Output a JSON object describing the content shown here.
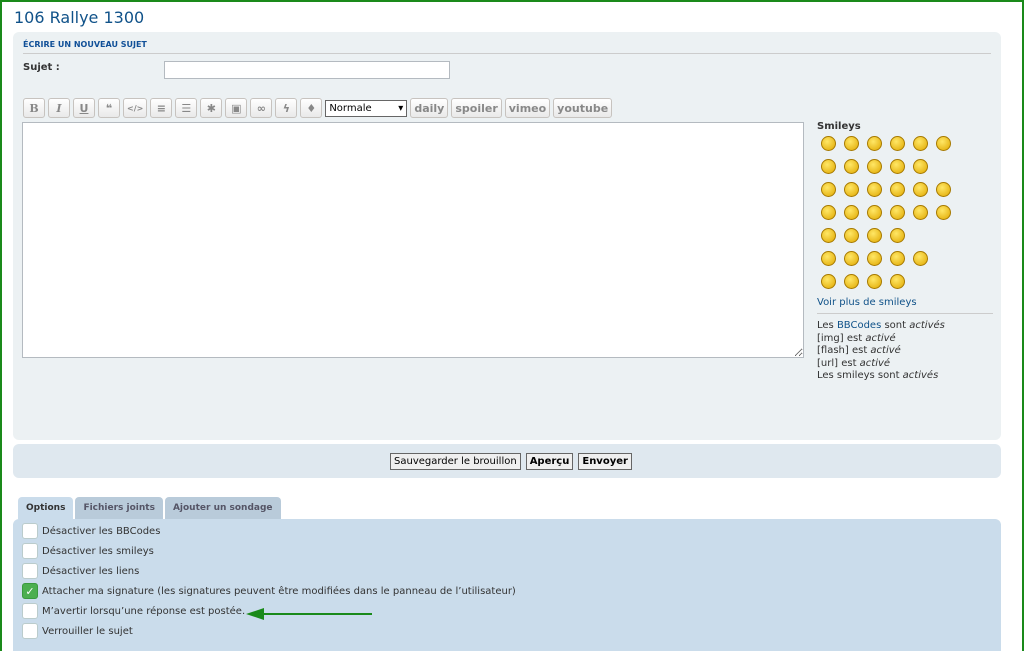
{
  "page": {
    "title": "106 Rallye 1300"
  },
  "form": {
    "header": "ÉCRIRE UN NOUVEAU SUJET",
    "subject_label": "Sujet :",
    "subject_value": ""
  },
  "toolbar": {
    "buttons": [
      "B",
      "I",
      "U",
      "❝",
      "</>",
      "≡",
      "☰",
      "✱",
      "▣",
      "∞",
      "ϟ",
      "♦"
    ],
    "font_size": "Normale",
    "extra": [
      "daily",
      "spoiler",
      "vimeo",
      "youtube"
    ]
  },
  "smileys": {
    "title": "Smileys",
    "rows": [
      6,
      5,
      6,
      6,
      4,
      5,
      4
    ],
    "more": "Voir plus de smileys"
  },
  "info": {
    "bbcode_pre": "Les ",
    "bbcode_link": "BBCodes",
    "bbcode_post": " sont ",
    "bbcode_state": "activés",
    "img": "[img] est ",
    "img_state": "activé",
    "flash": "[flash] est ",
    "flash_state": "activé",
    "url": "[url] est ",
    "url_state": "activé",
    "smileys": "Les smileys sont ",
    "smileys_state": "activés"
  },
  "actions": {
    "draft": "Sauvegarder le brouillon",
    "preview": "Aperçu",
    "submit": "Envoyer"
  },
  "tabs": [
    "Options",
    "Fichiers joints",
    "Ajouter un sondage"
  ],
  "options": [
    {
      "label": "Désactiver les BBCodes",
      "checked": false
    },
    {
      "label": "Désactiver les smileys",
      "checked": false
    },
    {
      "label": "Désactiver les liens",
      "checked": false
    },
    {
      "label": "Attacher ma signature (les signatures peuvent être modifiées dans le panneau de l’utilisateur)",
      "checked": true
    },
    {
      "label": "M’avertir lorsqu’une réponse est postée.",
      "checked": false
    },
    {
      "label": "Verrouiller le sujet",
      "checked": false
    }
  ],
  "colors": {
    "annotation_arrow": "#1a8a1a",
    "frame": "#1a8a1a"
  }
}
